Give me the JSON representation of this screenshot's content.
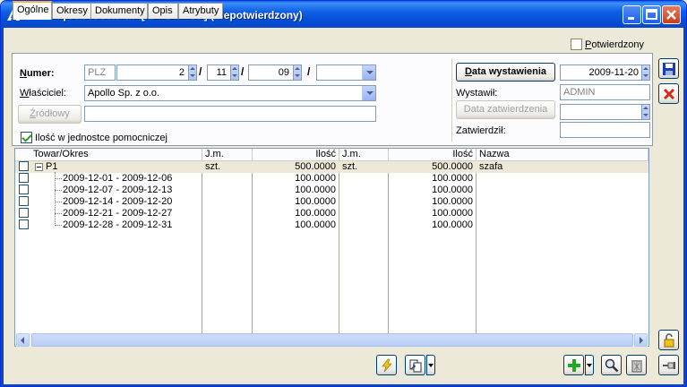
{
  "window": {
    "title": "Plan zapotrzebowania [PLZ-2/11/09]  (niepotwierdzony)"
  },
  "tabs": [
    {
      "label": "Ogólne",
      "active": true
    },
    {
      "label": "Okresy"
    },
    {
      "label": "Dokumenty"
    },
    {
      "label": "Opis"
    },
    {
      "label": "Atrybuty"
    }
  ],
  "header": {
    "confirmed_label": "Potwierdzony",
    "confirmed": false,
    "number_label": "Numer:",
    "number": {
      "prefix": "PLZ",
      "seq": "2",
      "month": "11",
      "year": "09",
      "suffix": ""
    },
    "owner_label": "Właściciel:",
    "owner": "Apollo Sp. z o.o.",
    "source_button": "Źródłowy",
    "source_value": "",
    "aux_unit_label": "Ilość w jednostce pomocniczej",
    "aux_unit_checked": true,
    "issue_date_button": "Data wystawienia",
    "issue_date": "2009-11-20",
    "issued_by_label": "Wystawił:",
    "issued_by": "ADMIN",
    "approval_date_button": "Data zatwierdzenia",
    "approval_date": "",
    "approved_by_label": "Zatwierdził:",
    "approved_by": ""
  },
  "grid": {
    "columns": [
      "Towar/Okres",
      "J.m.",
      "Ilość",
      "J.m.",
      "Ilość",
      "Nazwa"
    ],
    "rows": [
      {
        "name": "P1",
        "unit1": "szt.",
        "qty1": "500.0000",
        "unit2": "szt.",
        "qty2": "500.0000",
        "desc": "szafa",
        "parent": true
      },
      {
        "name": "2009-12-01 - 2009-12-06",
        "unit1": "",
        "qty1": "100.0000",
        "unit2": "",
        "qty2": "100.0000",
        "desc": ""
      },
      {
        "name": "2009-12-07 - 2009-12-13",
        "unit1": "",
        "qty1": "100.0000",
        "unit2": "",
        "qty2": "100.0000",
        "desc": ""
      },
      {
        "name": "2009-12-14 - 2009-12-20",
        "unit1": "",
        "qty1": "100.0000",
        "unit2": "",
        "qty2": "100.0000",
        "desc": ""
      },
      {
        "name": "2009-12-21 - 2009-12-27",
        "unit1": "",
        "qty1": "100.0000",
        "unit2": "",
        "qty2": "100.0000",
        "desc": ""
      },
      {
        "name": "2009-12-28 - 2009-12-31",
        "unit1": "",
        "qty1": "100.0000",
        "unit2": "",
        "qty2": "100.0000",
        "desc": ""
      }
    ]
  },
  "colors": {
    "titlebar": "#0a47c8",
    "window_bg": "#ece9d8",
    "selected_row": "#ede9d8",
    "active_tab_accent": "#f7b23e"
  }
}
